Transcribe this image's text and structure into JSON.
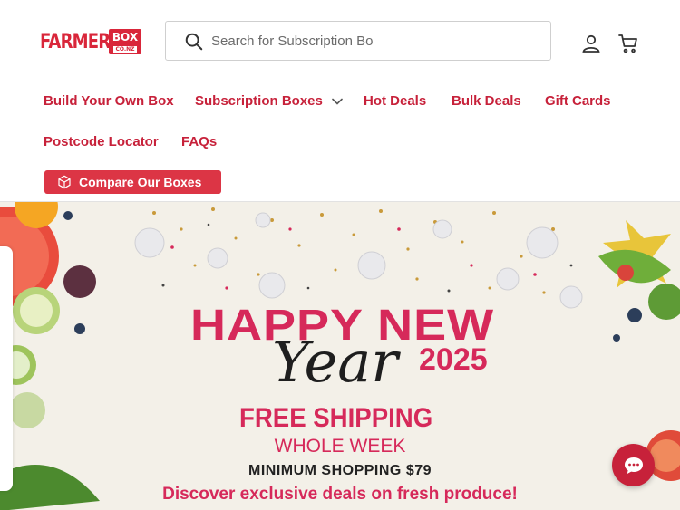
{
  "header": {
    "logo": {
      "main_text": "FARMERS",
      "box_text": "BOX",
      "domain_text": "CO.NZ"
    },
    "search": {
      "placeholder": "Search for Subscription Bo",
      "icon": "search-icon"
    },
    "account_icon": "account-icon",
    "cart_icon": "cart-icon"
  },
  "nav": {
    "items": [
      {
        "label": "Build Your Own Box"
      },
      {
        "label": "Subscription Boxes",
        "has_dropdown": true
      },
      {
        "label": "Hot Deals"
      },
      {
        "label": "Bulk Deals"
      },
      {
        "label": "Gift Cards"
      },
      {
        "label": "Postcode Locator"
      },
      {
        "label": "FAQs"
      }
    ],
    "compare_button": {
      "label": "Compare Our Boxes",
      "icon": "box-icon"
    }
  },
  "banner": {
    "headline": "HAPPY NEW",
    "script": "Year",
    "year": "2025",
    "offer": "FREE SHIPPING",
    "duration": "WHOLE WEEK",
    "minimum": "MINIMUM SHOPPING $79",
    "tagline": "Discover exclusive deals on fresh produce!"
  },
  "chat": {
    "icon": "chat-icon"
  },
  "colors": {
    "brand_red": "#c7213a",
    "banner_pink": "#d6295a",
    "button_red": "#dc3545"
  }
}
